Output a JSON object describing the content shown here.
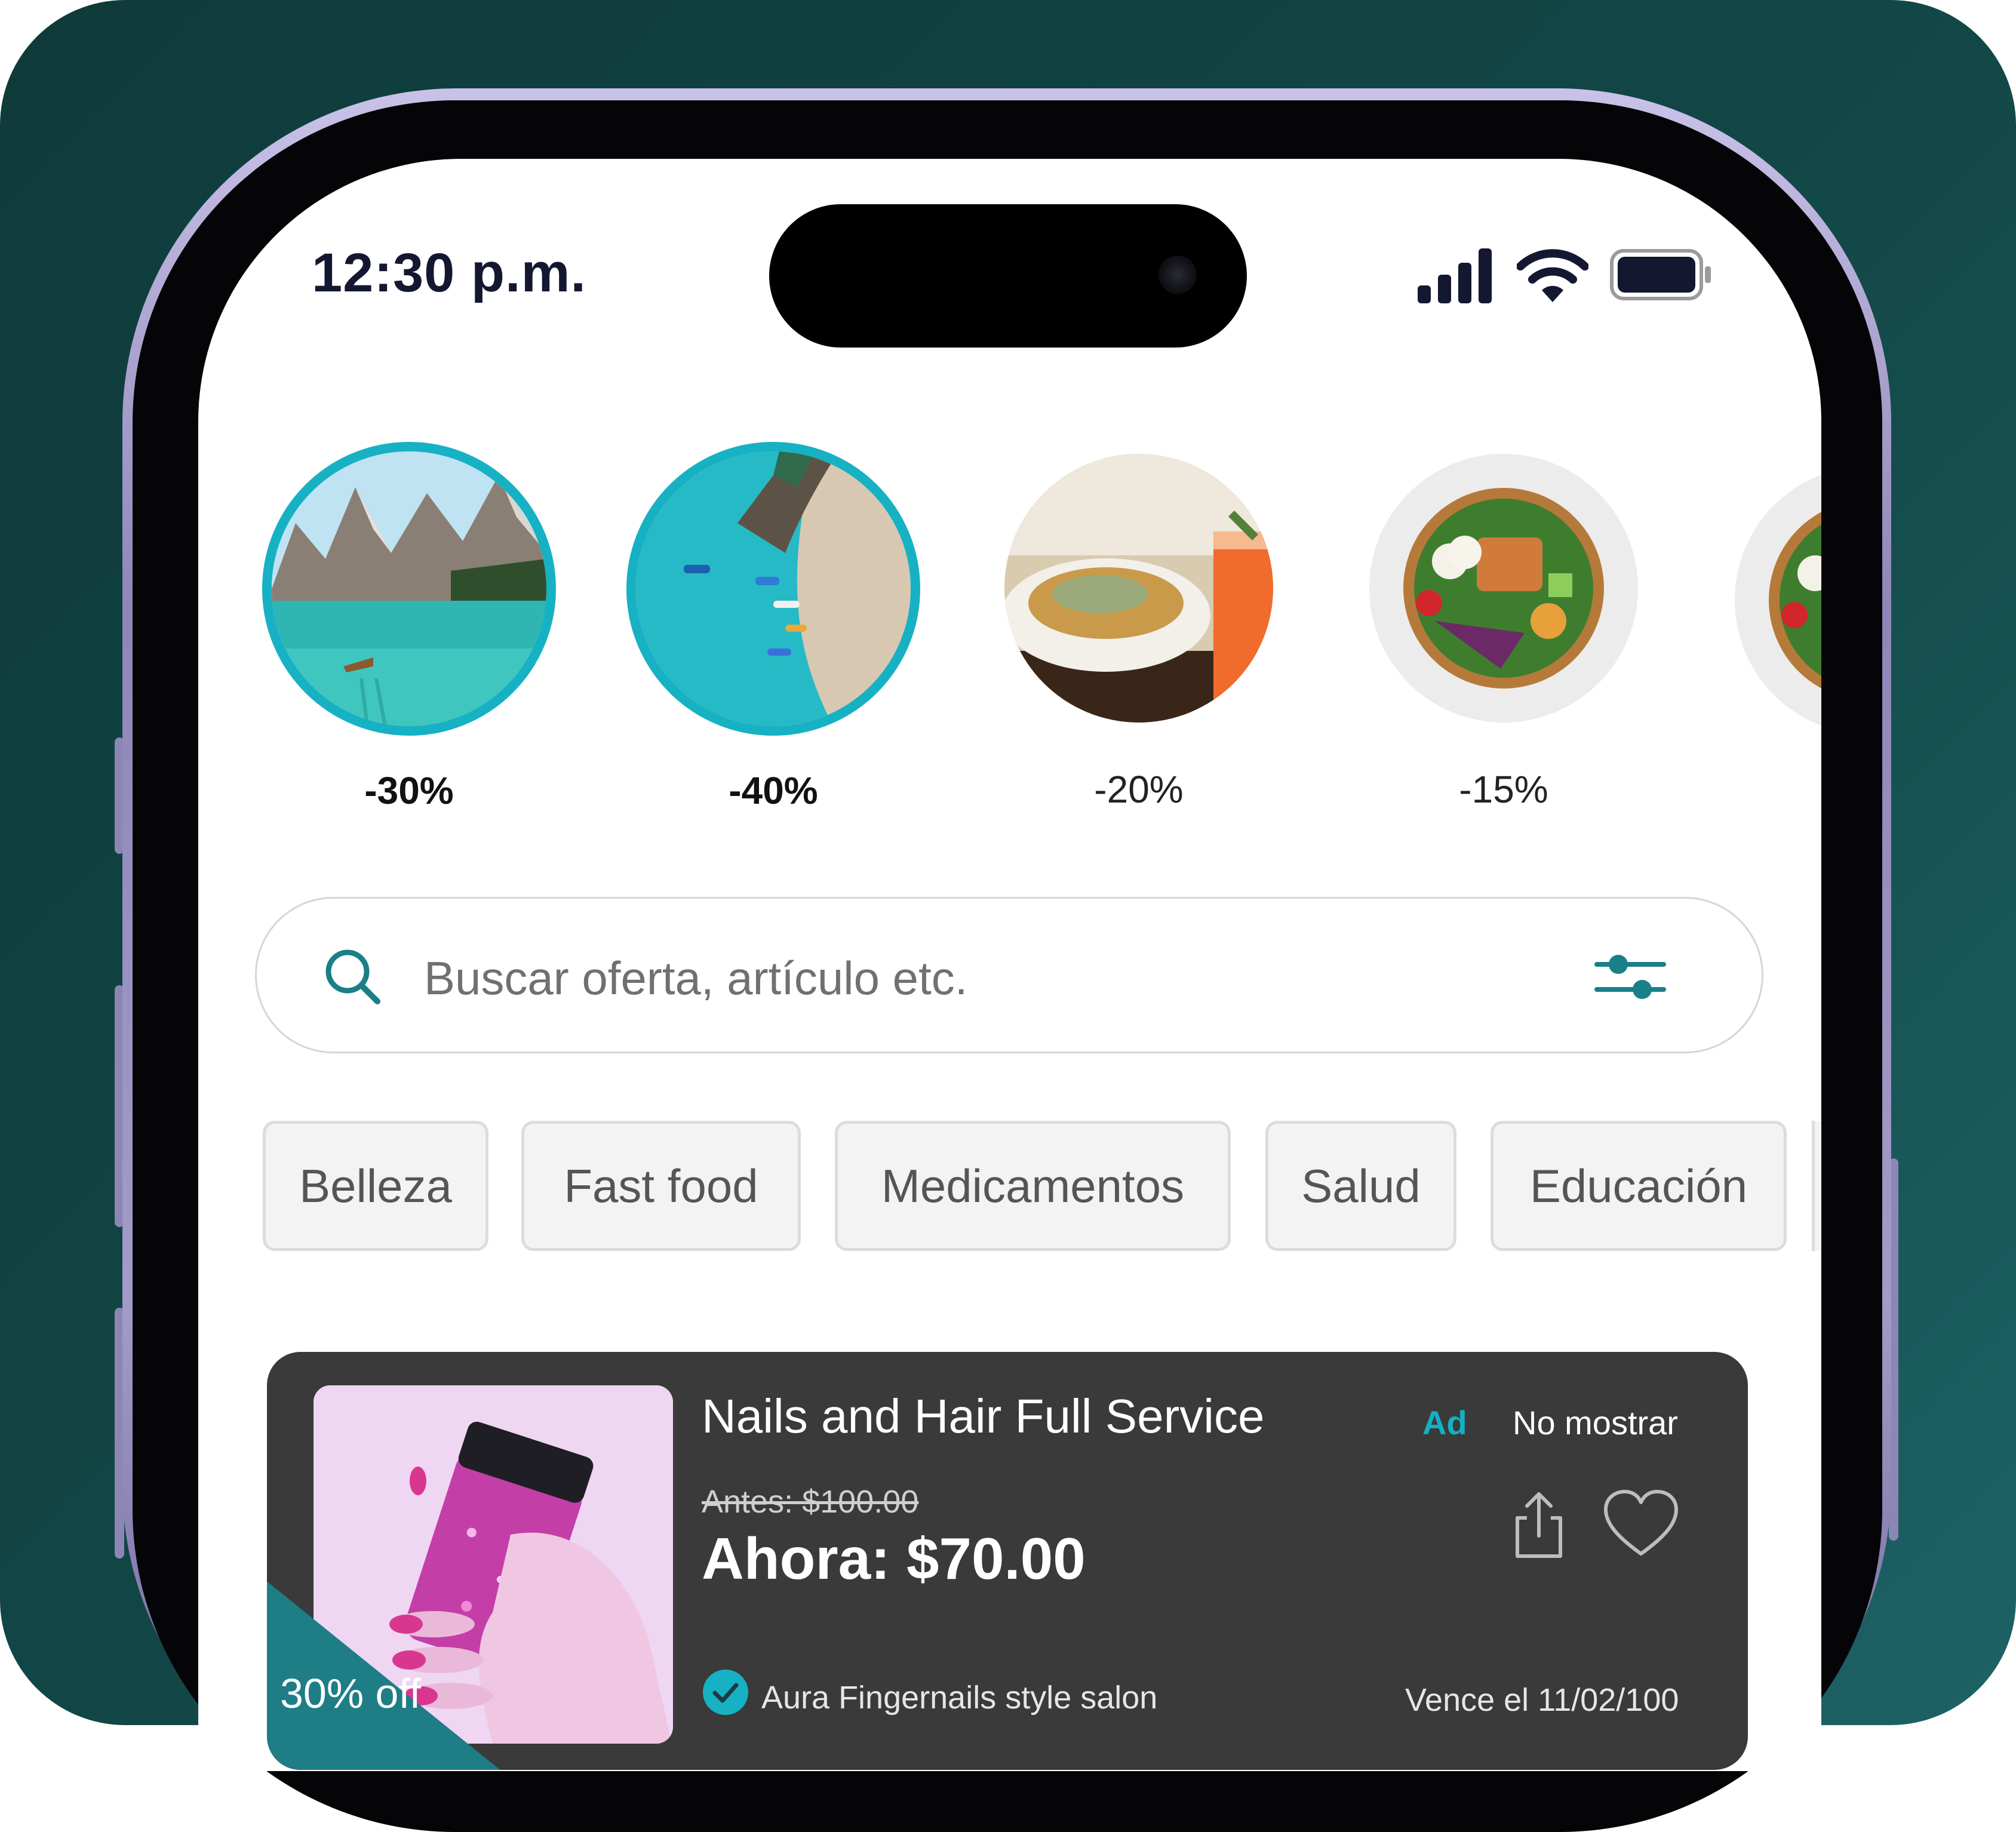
{
  "status_bar": {
    "time": "12:30 p.m."
  },
  "stories": [
    {
      "discount": "-30%",
      "active": true,
      "image": "mountain-lake"
    },
    {
      "discount": "-40%",
      "active": true,
      "image": "beach-aerial"
    },
    {
      "discount": "-20%",
      "active": false,
      "image": "fries-drink"
    },
    {
      "discount": "-15%",
      "active": false,
      "image": "salad-bowl"
    }
  ],
  "search": {
    "placeholder": "Buscar oferta, artículo etc."
  },
  "categories": [
    "Belleza",
    "Fast food",
    "Medicamentos",
    "Salud",
    "Educación"
  ],
  "offer_card": {
    "title": "Nails and Hair Full Service",
    "ad_label": "Ad",
    "hide_label": "No mostrar",
    "old_price": "Antes: $100.00",
    "new_price": "Ahora: $70.00",
    "discount_tag": "30% off",
    "merchant": "Aura Fingernails style salon",
    "expires": "Vence el 11/02/100"
  },
  "colors": {
    "accent": "#17b1c4",
    "background_teal": "#134848",
    "card_background": "#3a3a3a",
    "tag_teal": "#1f7d86"
  },
  "icons": [
    "signal-icon",
    "wifi-icon",
    "battery-icon",
    "search-icon",
    "filter-sliders-icon",
    "share-icon",
    "heart-icon",
    "verified-check-icon"
  ]
}
